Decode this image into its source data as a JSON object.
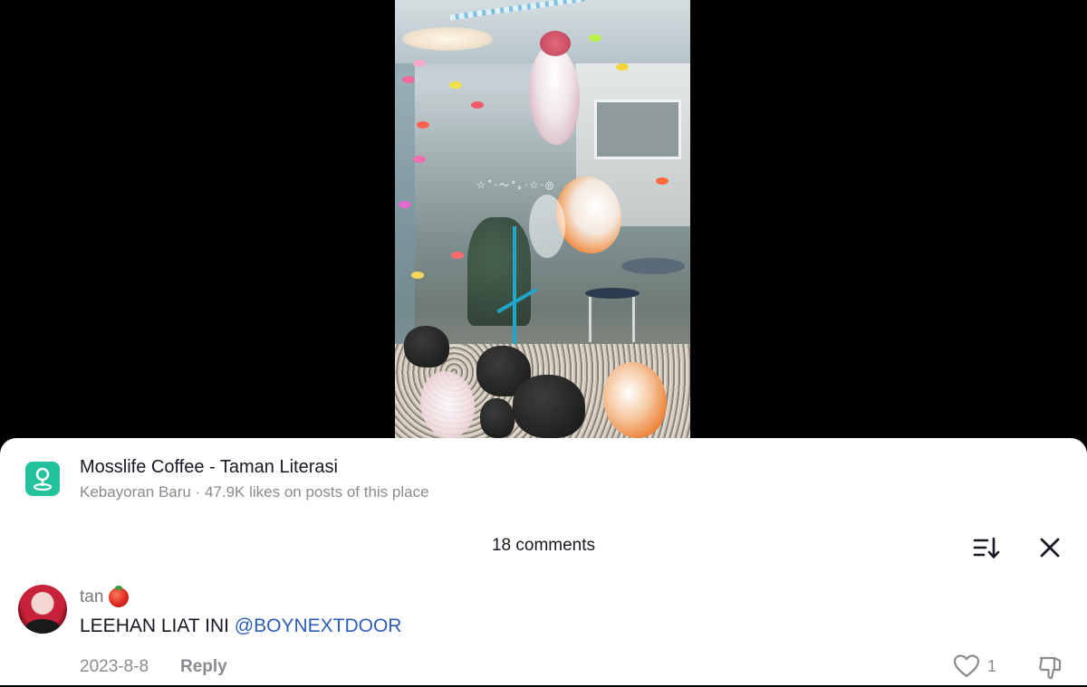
{
  "place": {
    "name": "Mosslife Coffee - Taman Literasi",
    "meta": "Kebayoran Baru · 47.9K likes on posts of this place",
    "icon": "location-pin-icon",
    "accent_color": "#22c39c"
  },
  "comments_panel": {
    "count_label": "18 comments",
    "sort_icon": "sort-icon",
    "close_icon": "close-icon"
  },
  "comment": {
    "username": "tan",
    "emoji_icon": "tomato-emoji-icon",
    "text_prefix": "LEEHAN LIAT INI ",
    "mention": "@BOYNEXTDOOR",
    "mention_color": "#2b5db9",
    "date": "2023-8-8",
    "reply_label": "Reply",
    "like_count": "1"
  }
}
